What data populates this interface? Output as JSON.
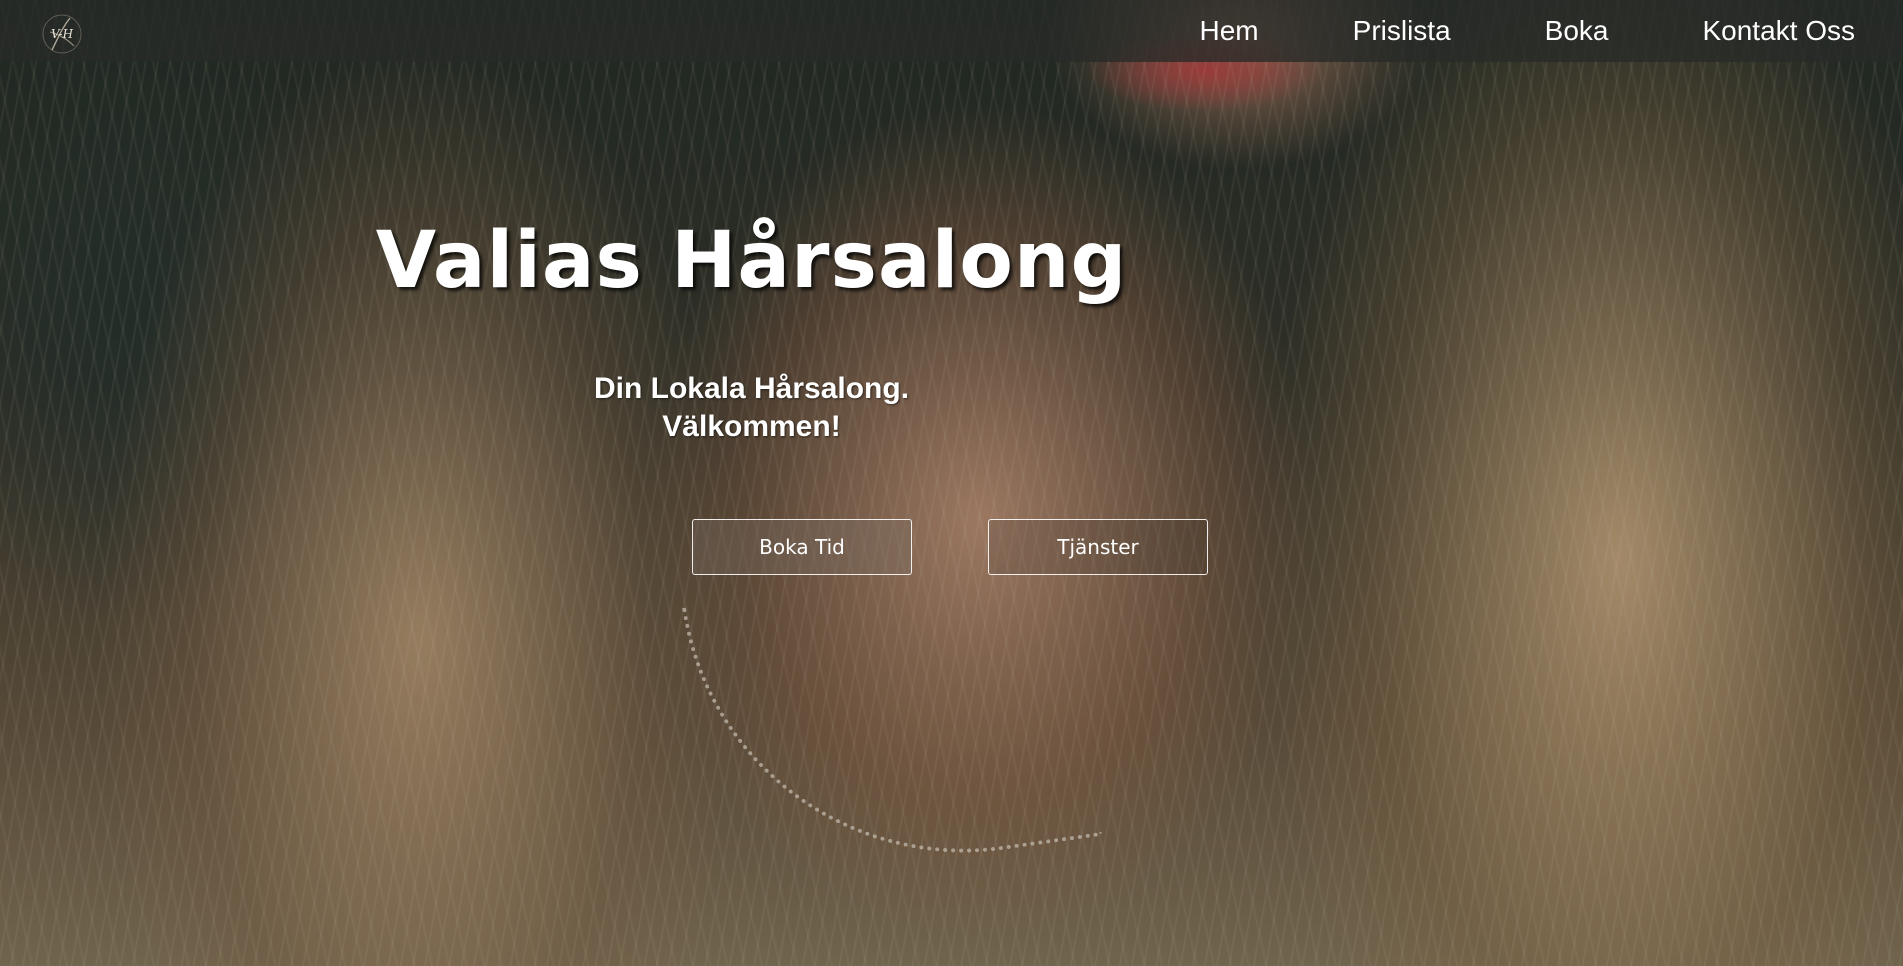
{
  "logo": {
    "text": "V-H"
  },
  "nav": {
    "items": [
      {
        "label": "Hem"
      },
      {
        "label": "Prislista"
      },
      {
        "label": "Boka"
      },
      {
        "label": "Kontakt Oss"
      }
    ]
  },
  "hero": {
    "title": "Valias Hårsalong",
    "subtitle_line1": "Din Lokala Hårsalong.",
    "subtitle_line2": "Välkommen!",
    "buttons": [
      {
        "label": "Boka Tid"
      },
      {
        "label": "Tjänster"
      }
    ]
  }
}
